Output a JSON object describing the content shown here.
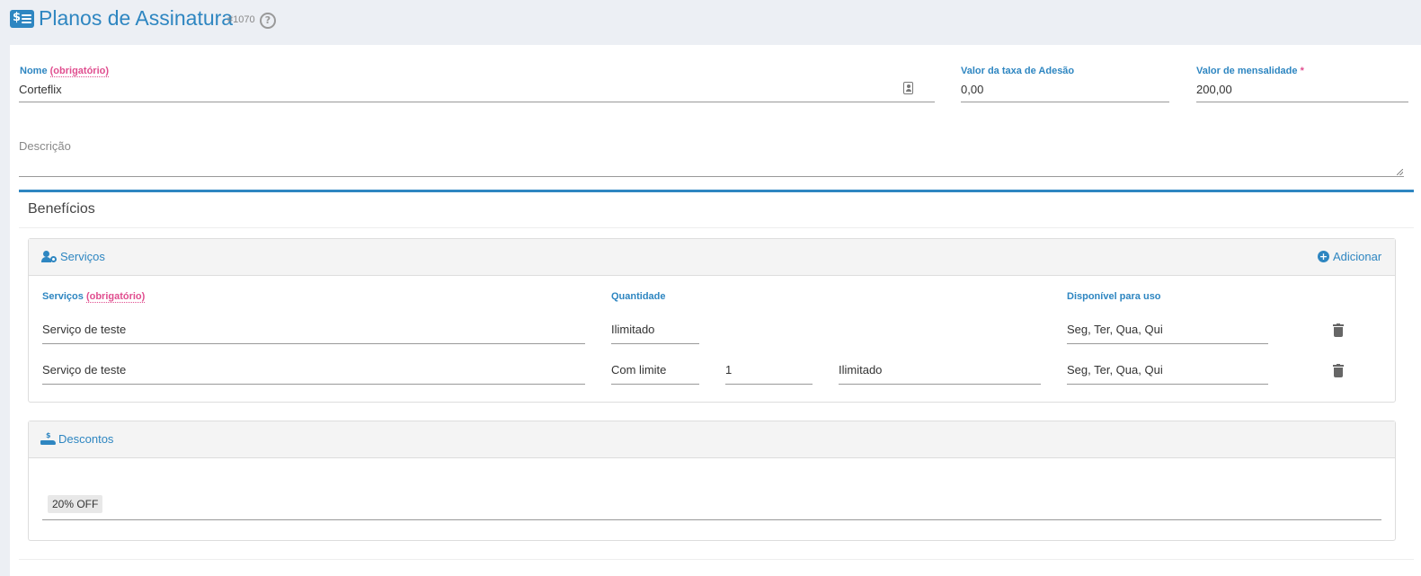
{
  "header": {
    "title": "Planos de Assinatura",
    "record_id": "#1070",
    "help": "?"
  },
  "form": {
    "nome": {
      "label": "Nome",
      "required_text": "(obrigatório)",
      "value": "Corteflix"
    },
    "taxa_adesao": {
      "label": "Valor da taxa de Adesão",
      "value": "0,00"
    },
    "mensalidade": {
      "label": "Valor de mensalidade",
      "required_mark": "*",
      "value": "200,00"
    },
    "descricao": {
      "placeholder": "Descrição"
    }
  },
  "beneficios": {
    "title": "Benefícios",
    "servicos": {
      "title": "Serviços",
      "add_label": "Adicionar",
      "columns": {
        "servicos": "Serviços",
        "servicos_required": "(obrigatório)",
        "quantidade": "Quantidade",
        "disponivel": "Disponível para uso"
      },
      "rows": [
        {
          "servico": "Serviço de teste",
          "quantidade": "Ilimitado",
          "disponivel": "Seg, Ter, Qua, Qui"
        },
        {
          "servico": "Serviço de teste",
          "quantidade": "Com limite",
          "limite": "1",
          "periodo": "Ilimitado",
          "disponivel": "Seg, Ter, Qua, Qui"
        }
      ]
    },
    "descontos": {
      "title": "Descontos",
      "tags": [
        "20% OFF"
      ]
    }
  },
  "colors": {
    "accent": "#2e86c1",
    "required": "#e04e8f"
  },
  "icons": [
    "money-list-icon",
    "help-circle-icon",
    "contact-card-icon",
    "users-gear-icon",
    "plus-circle-icon",
    "trash-icon",
    "hand-coin-icon"
  ]
}
